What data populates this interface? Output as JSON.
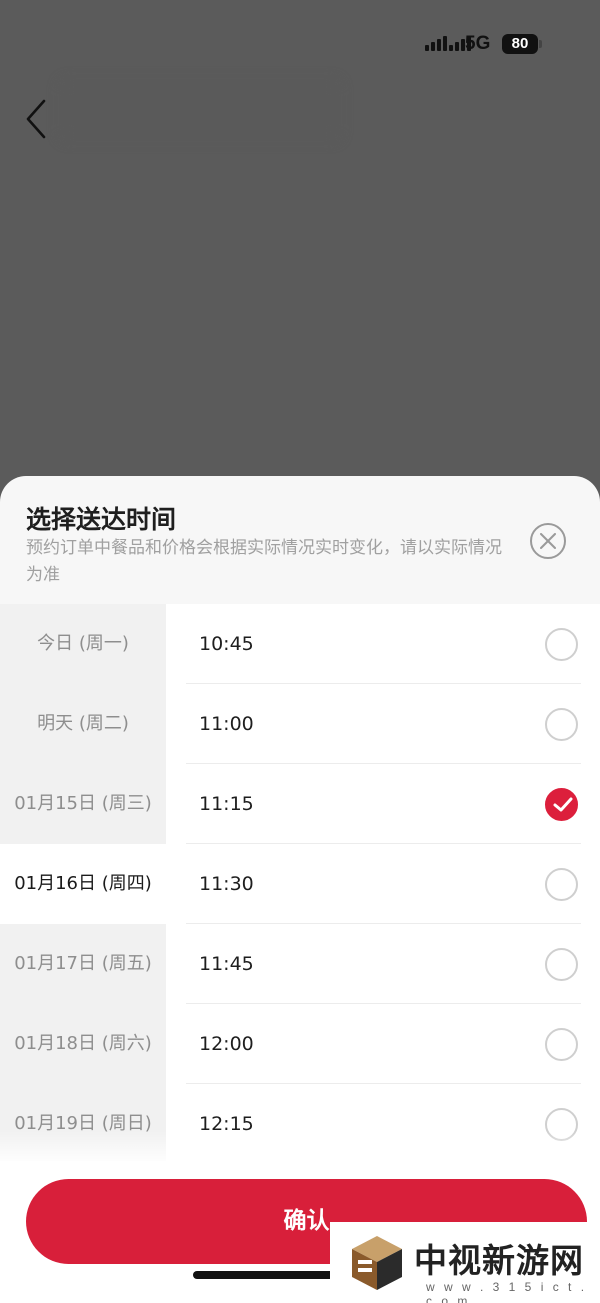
{
  "status_bar": {
    "network": "5G",
    "battery": "80"
  },
  "sheet": {
    "title": "选择送达时间",
    "subtitle": "预约订单中餐品和价格会根据实际情况实时变化，请以实际情况为准",
    "dates": [
      {
        "label": "今日 (周一)",
        "selected": false
      },
      {
        "label": "明天 (周二)",
        "selected": false
      },
      {
        "label": "01月15日 (周三)",
        "selected": false
      },
      {
        "label": "01月16日 (周四)",
        "selected": true
      },
      {
        "label": "01月17日 (周五)",
        "selected": false
      },
      {
        "label": "01月18日 (周六)",
        "selected": false
      },
      {
        "label": "01月19日 (周日)",
        "selected": false
      }
    ],
    "times": [
      {
        "label": "10:45",
        "checked": false
      },
      {
        "label": "11:00",
        "checked": false
      },
      {
        "label": "11:15",
        "checked": true
      },
      {
        "label": "11:30",
        "checked": false
      },
      {
        "label": "11:45",
        "checked": false
      },
      {
        "label": "12:00",
        "checked": false
      },
      {
        "label": "12:15",
        "checked": false
      }
    ],
    "confirm_label": "确认"
  },
  "watermark": {
    "name": "中视新游网",
    "url": "w w w . 3 1 5 i c t . c o m"
  },
  "colors": {
    "accent": "#d81f3a",
    "overlay": "#5b5b5b"
  }
}
